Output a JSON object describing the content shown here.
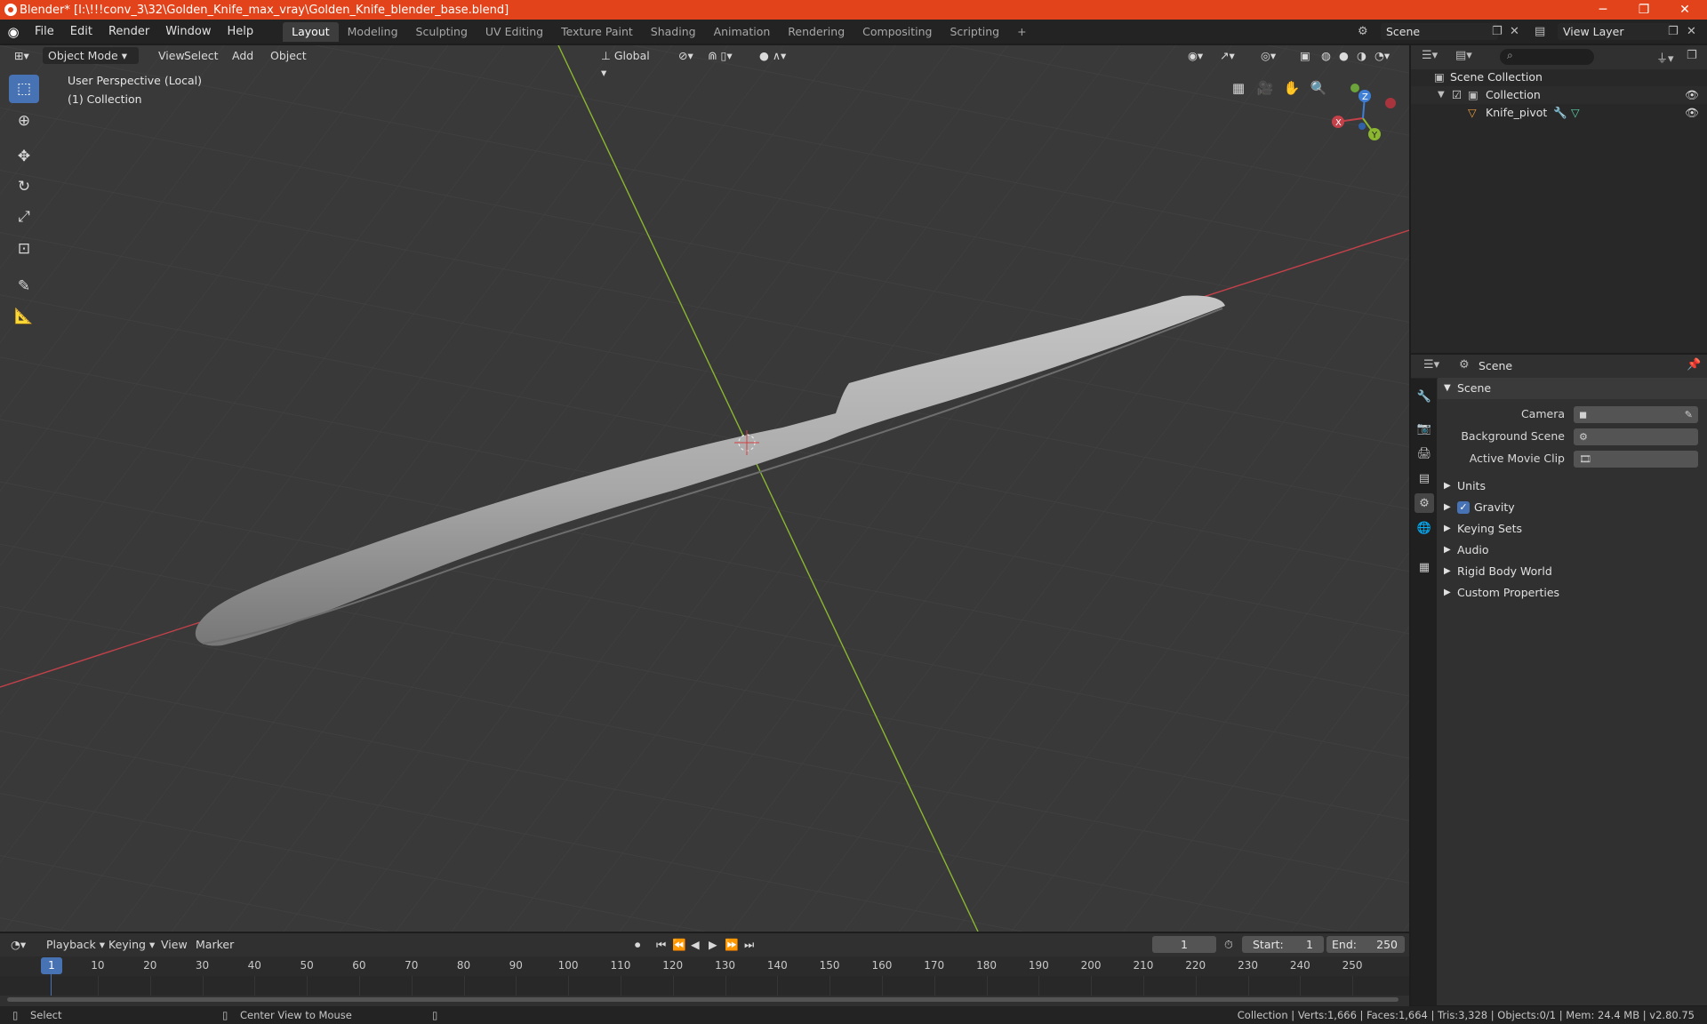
{
  "window": {
    "title": "Blender* [I:\\!!!conv_3\\32\\Golden_Knife_max_vray\\Golden_Knife_blender_base.blend]",
    "minimize": "─",
    "maximize": "❐",
    "close": "✕"
  },
  "menu": [
    "File",
    "Edit",
    "Render",
    "Window",
    "Help"
  ],
  "workspaces": [
    "Layout",
    "Modeling",
    "Sculpting",
    "UV Editing",
    "Texture Paint",
    "Shading",
    "Animation",
    "Rendering",
    "Compositing",
    "Scripting"
  ],
  "workspace_active": "Layout",
  "add_workspace": "+",
  "scene_name": "Scene",
  "view_layer_name": "View Layer",
  "viewport": {
    "mode": "Object Mode",
    "menus": [
      "View",
      "Select",
      "Add",
      "Object"
    ],
    "orientation": "Global",
    "info_line1": "User Perspective (Local)",
    "info_line2": "(1) Collection",
    "gizmo": {
      "x": "X",
      "y": "Y",
      "z": "Z"
    }
  },
  "outliner": {
    "root": "Scene Collection",
    "collection": "Collection",
    "object": "Knife_pivot"
  },
  "properties": {
    "header": "Scene",
    "panel_title": "Scene",
    "camera_label": "Camera",
    "background_scene_label": "Background Scene",
    "active_movie_clip_label": "Active Movie Clip",
    "panels": [
      "Units",
      "Gravity",
      "Keying Sets",
      "Audio",
      "Rigid Body World",
      "Custom Properties"
    ]
  },
  "timeline": {
    "menus": [
      "Playback",
      "Keying",
      "View",
      "Marker"
    ],
    "current_frame": "1",
    "start_label": "Start:",
    "start_value": "1",
    "end_label": "End:",
    "end_value": "250",
    "ruler": [
      "1",
      "10",
      "20",
      "30",
      "40",
      "50",
      "60",
      "70",
      "80",
      "90",
      "100",
      "110",
      "120",
      "130",
      "140",
      "150",
      "160",
      "170",
      "180",
      "190",
      "200",
      "210",
      "220",
      "230",
      "240",
      "250"
    ]
  },
  "statusbar": {
    "select": "Select",
    "center": "Center View to Mouse",
    "stats": "Collection | Verts:1,666 | Faces:1,664 | Tris:3,328 | Objects:0/1 | Mem: 24.4 MB | v2.80.75"
  },
  "colors": {
    "titlebar": "#e3431a",
    "accent": "#4772b3",
    "x_axis": "#c4414a",
    "y_axis": "#8bb630",
    "z_axis": "#3f7fd6"
  }
}
